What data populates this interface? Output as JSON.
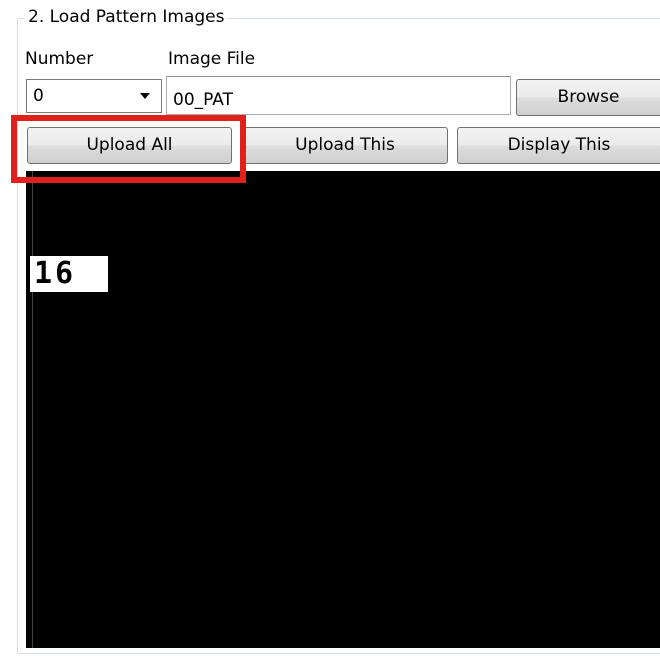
{
  "group": {
    "title": "2. Load Pattern Images"
  },
  "labels": {
    "number": "Number",
    "image_file": "Image File"
  },
  "number_select": {
    "value": "0"
  },
  "image_file_input": {
    "value": "00_PAT"
  },
  "buttons": {
    "browse": "Browse",
    "upload_all": "Upload All",
    "upload_this": "Upload This",
    "display_this": "Display This"
  },
  "display": {
    "count": "16"
  },
  "colors": {
    "highlight": "#e0201b",
    "display_bg": "#000000"
  },
  "icons": {
    "dropdown": "chevron-down-icon"
  }
}
